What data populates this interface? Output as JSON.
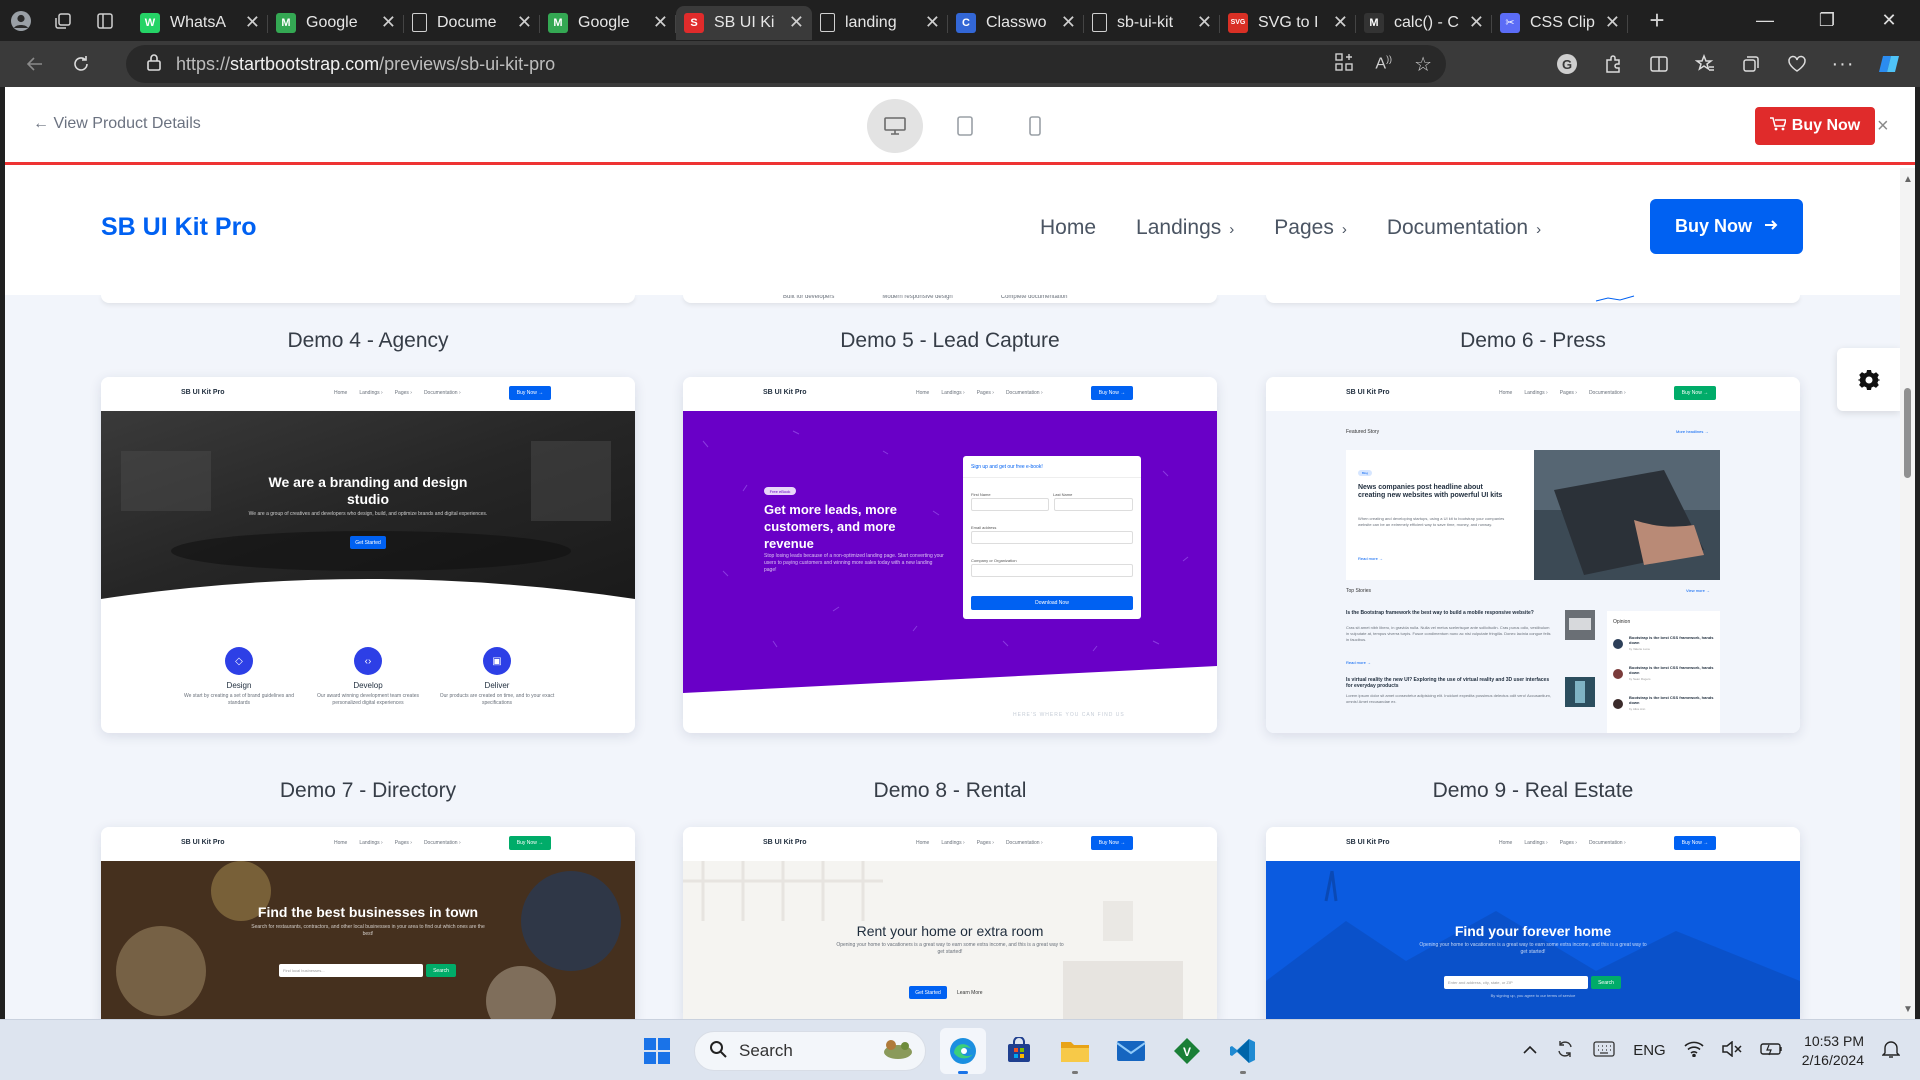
{
  "browser": {
    "tabs": [
      {
        "label": "WhatsA",
        "color": "#25d366",
        "glyph": "W"
      },
      {
        "label": "Google",
        "color": "#34a853",
        "glyph": "M"
      },
      {
        "label": "Docume",
        "color": "#cfcfcf",
        "glyph": ""
      },
      {
        "label": "Google",
        "color": "#34a853",
        "glyph": "M"
      },
      {
        "label": "SB UI Ki",
        "color": "#e02b2b",
        "glyph": "S",
        "active": true
      },
      {
        "label": "landing",
        "color": "#cfcfcf",
        "glyph": ""
      },
      {
        "label": "Classwo",
        "color": "#3367d6",
        "glyph": "C"
      },
      {
        "label": "sb-ui-kit",
        "color": "#cfcfcf",
        "glyph": ""
      },
      {
        "label": "SVG to I",
        "color": "#d93025",
        "glyph": "SVG"
      },
      {
        "label": "calc() - C",
        "color": "#333333",
        "glyph": "M"
      },
      {
        "label": "CSS Clip",
        "color": "#5b6cf6",
        "glyph": "✂"
      }
    ],
    "address": {
      "scheme": "https://",
      "host": "startbootstrap.com",
      "path": "/previews/sb-ui-kit-pro"
    }
  },
  "preview_bar": {
    "back_label": "← View Product Details",
    "buy_label": "Buy Now",
    "close": "×"
  },
  "site": {
    "brand": "SB UI Kit Pro",
    "nav": [
      "Home",
      "Landings",
      "Pages",
      "Documentation"
    ],
    "buy_label": "Buy Now",
    "peek_texts": [
      "Built for developers",
      "Modern responsive design",
      "Complete documentation"
    ]
  },
  "demos": [
    {
      "title": "Demo 4 - Agency"
    },
    {
      "title": "Demo 5 - Lead Capture"
    },
    {
      "title": "Demo 6 - Press"
    },
    {
      "title": "Demo 7 - Directory"
    },
    {
      "title": "Demo 8 - Rental"
    },
    {
      "title": "Demo 9 - Real Estate"
    }
  ],
  "thumbs": {
    "mini_brand": "SB UI Kit Pro",
    "mini_links": [
      "Home",
      "Landings ›",
      "Pages ›",
      "Documentation ›"
    ],
    "mini_buy": "Buy Now →",
    "agency": {
      "heading": "We are a branding and design studio",
      "sub": "We are a group of creatives and developers who design, build, and optimize brands and digital experiences.",
      "cta": "Get Started",
      "features": [
        {
          "title": "Design",
          "desc": "We start by creating a set of brand guidelines and standards"
        },
        {
          "title": "Develop",
          "desc": "Our award winning development team creates personalized digital experiences"
        },
        {
          "title": "Deliver",
          "desc": "Our products are created on time, and to your exact specifications"
        }
      ]
    },
    "lead": {
      "badge": "Free eBook",
      "heading": "Get more leads, more customers, and more revenue",
      "sub": "Stop losing leads because of a non-optimized landing page. Start converting your users to paying customers and winning more sales today with a new landing page!",
      "form_title": "Sign up and get our free e-book!",
      "first": "First Name",
      "last": "Last Name",
      "email": "Email address",
      "company": "Company or Organization",
      "submit": "Download Now",
      "footer": "HERE'S WHERE YOU CAN FIND US"
    },
    "press": {
      "featured": "Featured Story",
      "more": "More headlines →",
      "tag": "Blog",
      "headline": "News companies post headline about creating new websites with powerful UI kits",
      "body": "When creating and developing startups, using a UI kit to bootstrap your companies website can be an extremely efficient way to save time, money, and runway.",
      "read_more": "Read more →",
      "top": "Top Stories",
      "view_more": "View more →",
      "story1": "Is the Bootstrap framework the best way to build a mobile responsive website?",
      "story1_body": "Cras sit amet nibh libero, in gravida nulla. Nulla vel metus scelerisque ante sollicitudin. Cras purus odio, vestibulum in vulputate at, tempus viverra turpis. Fusce condimentum nunc ac nisi vulputate fringilla. Donec lacinia congue felis in faucibus.",
      "story1_read": "Read more →",
      "story2": "Is virtual reality the new UI? Exploring the use of virtual reality and 3D user interfaces for everyday products",
      "story2_body": "Lorem ipsum dolor sit amet consectetur adipisicing elit. Incidunt expedita possimus delectus odit vero! Accusantium, omnis! Amet recusandae ex.",
      "opinion": "Opinion",
      "ops": [
        {
          "t": "Bootstrap is the best CSS framework, hands down",
          "by": "by Valerie Luna"
        },
        {
          "t": "Bootstrap is the best CSS framework, hands down",
          "by": "by Sean Rogers"
        },
        {
          "t": "Bootstrap is the best CSS framework, hands down",
          "by": "by Alice Ann"
        }
      ]
    },
    "directory": {
      "heading": "Find the best businesses in town",
      "sub": "Search for restaurants, contractors, and other local businesses in your area to find out which ones are the best!",
      "placeholder": "Find local businesses...",
      "cta": "Search"
    },
    "rental": {
      "heading": "Rent your home or extra room",
      "sub": "Opening your home to vacationers is a great way to earn some extra income, and this is a great way to get started!",
      "cta": "Get Started",
      "secondary": "Learn More"
    },
    "realestate": {
      "heading": "Find your forever home",
      "sub": "Opening your home to vacationers is a great way to earn some extra income, and this is a great way to get started!",
      "placeholder": "Enter and address, city, state, or ZIP",
      "cta": "Search",
      "fine": "By signing up, you agree to our terms of service"
    }
  },
  "taskbar": {
    "search": "Search",
    "lang": "ENG",
    "time": "10:53 PM",
    "date": "2/16/2024"
  }
}
